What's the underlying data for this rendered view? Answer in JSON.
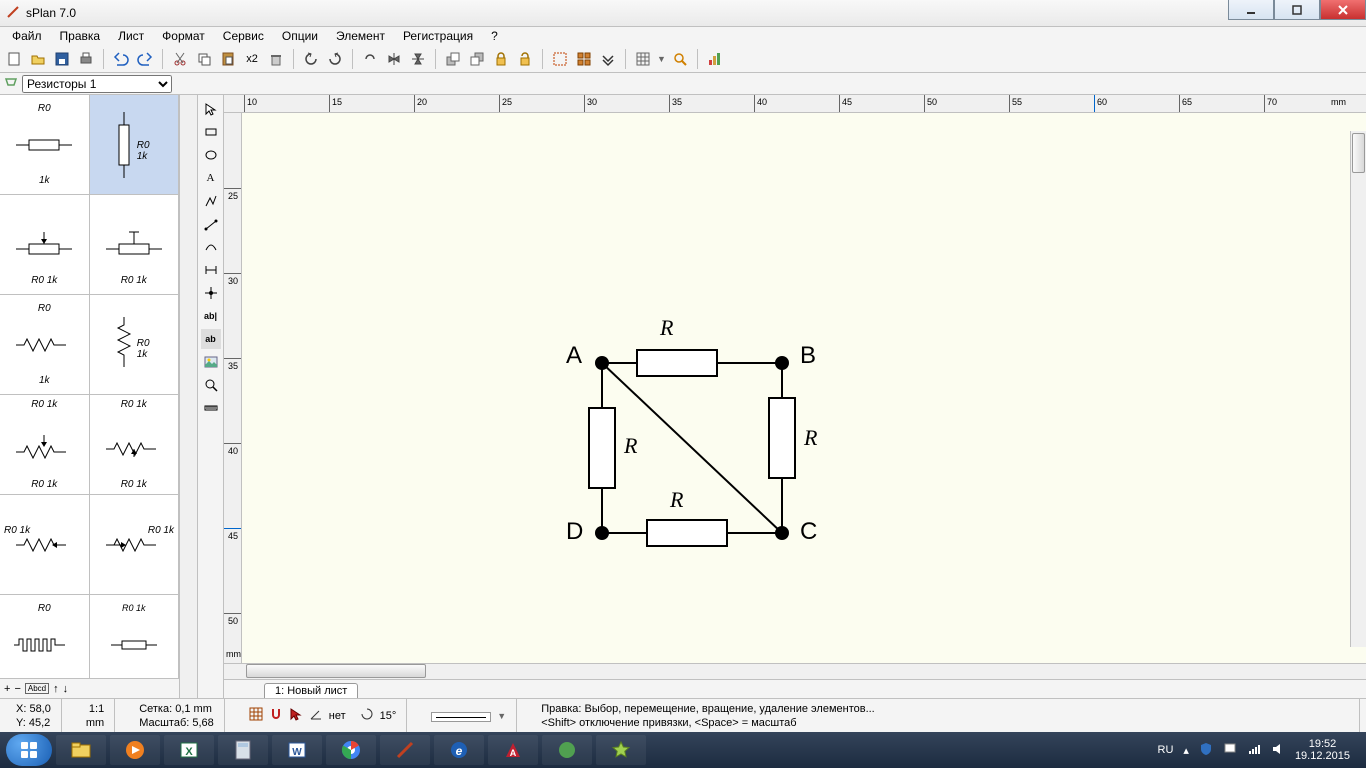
{
  "window": {
    "title": "sPlan 7.0"
  },
  "menu": [
    "Файл",
    "Правка",
    "Лист",
    "Формат",
    "Сервис",
    "Опции",
    "Элемент",
    "Регистрация",
    "?"
  ],
  "toolbar": {
    "scale_label": "x2"
  },
  "library": {
    "dropdown": "Резисторы 1",
    "items": [
      {
        "top": "R0",
        "bot": "1k"
      },
      {
        "top": "R0",
        "bot": "1k",
        "selected": true
      },
      {
        "top": "",
        "bot": "R0   1k"
      },
      {
        "top": "",
        "bot": "R0 1k"
      },
      {
        "top": "R0",
        "bot": "1k"
      },
      {
        "top": "R0",
        "bot": "1k"
      },
      {
        "top": "R0 1k",
        "bot": "R0 1k"
      },
      {
        "top": "R0 1k",
        "bot": "R0 1k"
      },
      {
        "top": "R0 1k",
        "bot": ""
      },
      {
        "top": "R0 1k",
        "bot": ""
      },
      {
        "top": "R0",
        "bot": ""
      },
      {
        "top": "R0 1k",
        "bot": ""
      }
    ]
  },
  "hruler": {
    "ticks": [
      "10",
      "15",
      "20",
      "25",
      "30",
      "35",
      "40",
      "45",
      "50",
      "55",
      "60",
      "65",
      "70"
    ],
    "unit": "mm"
  },
  "vruler": {
    "ticks": [
      "25",
      "30",
      "35",
      "40",
      "45",
      "50"
    ],
    "unit": "mm"
  },
  "circuit": {
    "nodes": {
      "A": "A",
      "B": "B",
      "C": "C",
      "D": "D"
    },
    "res_label": "R"
  },
  "pagetab": "1: Новый лист",
  "status": {
    "coords": {
      "x": "X: 58,0",
      "y": "Y: 45,2"
    },
    "scale": {
      "ratio": "1:1",
      "unit": "mm"
    },
    "grid": {
      "label": "Сетка: 0,1 mm",
      "zoom": "Масштаб:  5,68"
    },
    "snap_off": "нет",
    "angle": "15°",
    "help1": "Правка: Выбор, перемещение, вращение, удаление элементов...",
    "help2": "<Shift> отключение привязки, <Space> =  масштаб"
  },
  "tray": {
    "lang": "RU",
    "time": "19:52",
    "date": "19.12.2015"
  }
}
